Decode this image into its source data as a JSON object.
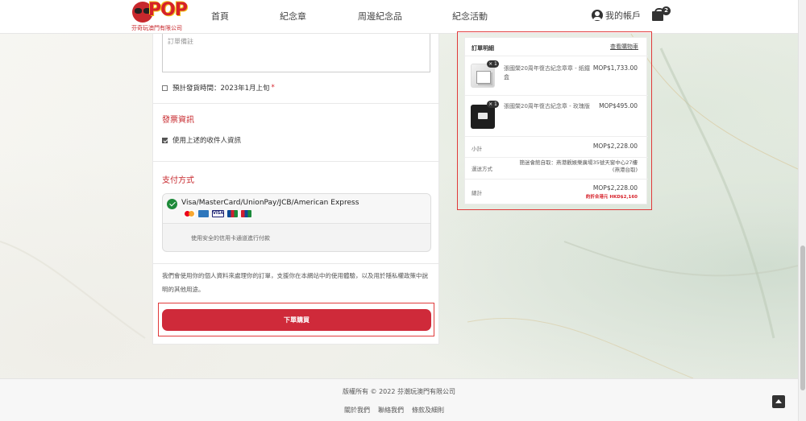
{
  "header": {
    "logo_text": "POP",
    "logo_subtitle": "芬奇玩澳門有限公司",
    "nav": [
      "首頁",
      "紀念章",
      "周邊紀念品",
      "紀念活動"
    ],
    "account_label": "我的帳戶",
    "cart_count": "2"
  },
  "form": {
    "notes_placeholder": "訂單備註",
    "ship_time_label": "預計發貨時間：2023年1月上旬",
    "required_mark": "*",
    "invoice_title": "發票資訊",
    "use_recipient_label": "使用上述的收件人資訊",
    "payment_title": "支付方式",
    "payment_method_label": "Visa/MasterCard/UnionPay/JCB/American Express",
    "card_icons": [
      "mastercard-icon",
      "amex-icon",
      "visa-icon",
      "jcb-icon",
      "unionpay-icon"
    ],
    "visa_text": "VISA",
    "payment_note": "使用安全的信用卡通道進行付款",
    "privacy_text": "我們會使用你的個人資料來處理你的訂單，支援你在本網站中的使用體驗，以及用於隱私權政策中說明的其他用途。",
    "order_button": "下單購買"
  },
  "summary": {
    "title": "訂單明細",
    "view_cart_link": "查看購物車",
    "items": [
      {
        "qty": "× 1",
        "name": "張國榮20周年復古紀念章章 - 紙鐵盒",
        "price": "MOP$1,733.00"
      },
      {
        "qty": "× 1",
        "name": "張國榮20周年復古紀念章 - 玫瑰版",
        "price": "MOP$495.00"
      }
    ],
    "subtotal_label": "小計",
    "subtotal_value": "MOP$2,228.00",
    "shipping_label": "運送方式",
    "shipping_value": "簡迷會館自取：燕港觀娛樂廣場35號天窗中心27樓 (燕港台取)",
    "total_label": "總計",
    "total_value": "MOP$2,228.00",
    "total_approx": "約折合港元 HKD$2,160"
  },
  "footer": {
    "copyright": "版權所有 © 2022 芬潮玩澳門有限公司",
    "links": [
      "關於我們",
      "聯絡我們",
      "條款及細則"
    ]
  },
  "colors": {
    "accent_red": "#cf2a3a",
    "section_red": "#c7282d",
    "success_green": "#1e8a3a"
  }
}
